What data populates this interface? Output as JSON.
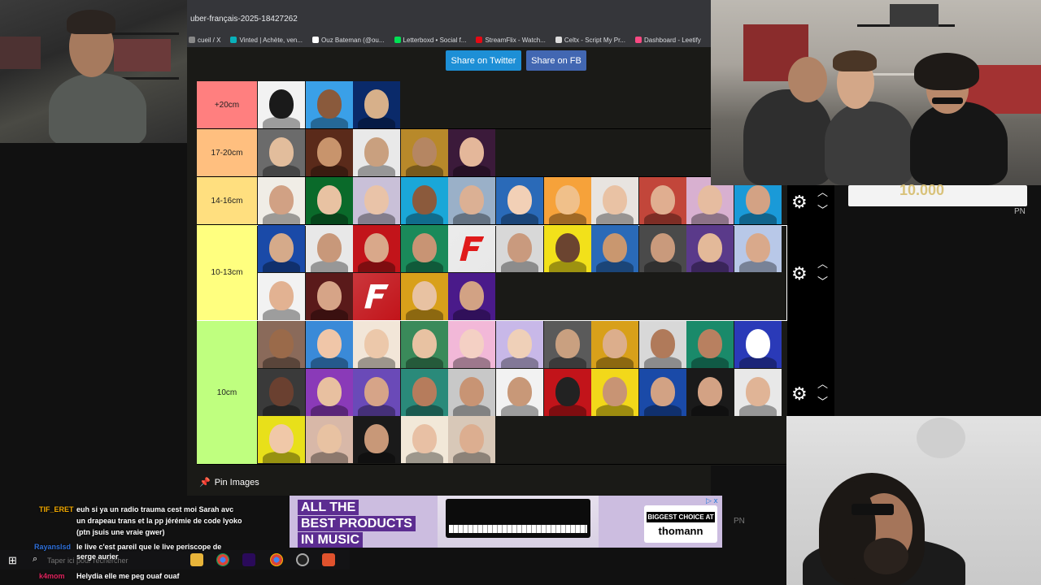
{
  "browser": {
    "url": "uber-français-2025-18427262",
    "bookmarks": [
      {
        "label": "cueil / X",
        "color": "#888888"
      },
      {
        "label": "Vinted | Achète, ven...",
        "color": "#09b1ba"
      },
      {
        "label": "Ouz Bateman (@ou...",
        "color": "#ffffff"
      },
      {
        "label": "Letterboxd • Social f...",
        "color": "#00e054"
      },
      {
        "label": "StreamFlix - Watch...",
        "color": "#e50914"
      },
      {
        "label": "Celtx - Script My Pr...",
        "color": "#dddddd"
      },
      {
        "label": "Dashboard - Leetify",
        "color": "#f84982"
      }
    ]
  },
  "share": {
    "twitter_label": "Share on Twitter",
    "fb_label": "Share on FB"
  },
  "tiers": [
    {
      "label": "+20cm",
      "color": "#ff7f7f",
      "items": 3
    },
    {
      "label": "17-20cm",
      "color": "#ffbf7f",
      "items": 5
    },
    {
      "label": "14-16cm",
      "color": "#ffdf7f",
      "items": 11
    },
    {
      "label": "10-13cm",
      "color": "#ffff7f",
      "items": 16
    },
    {
      "label": "10cm",
      "color": "#bfff7f",
      "items": 27
    }
  ],
  "pin": {
    "icon": "pin-icon",
    "label": "Pin Images"
  },
  "coin_panel": {
    "value": "10.000",
    "tag": "PN"
  },
  "ad": {
    "headline": [
      "ALL THE",
      "BEST PRODUCTS",
      "IN MUSIC"
    ],
    "tagline": "BIGGEST CHOICE AT",
    "brand": "thomann",
    "tag": "PN"
  },
  "chat": [
    {
      "user": "TIF_ERET",
      "user_color": "#f2a900",
      "lines": [
        "euh si ya un radio trauma cest moi Sarah avc",
        "un drapeau trans et la pp jérémie de code lyoko",
        "(ptn jsuis une vraie gwer)"
      ]
    },
    {
      "user": "Rayanslsd",
      "user_color": "#2e6fd8",
      "lines": [
        "le live c'est pareil que le live periscope de",
        "serge aurier"
      ]
    },
    {
      "user": "k4mom",
      "user_color": "#e0245e",
      "lines": [
        "Helydia elle me peg ouaf ouaf"
      ]
    }
  ],
  "taskbar": {
    "search_placeholder": "Taper ici pour rechercher"
  }
}
